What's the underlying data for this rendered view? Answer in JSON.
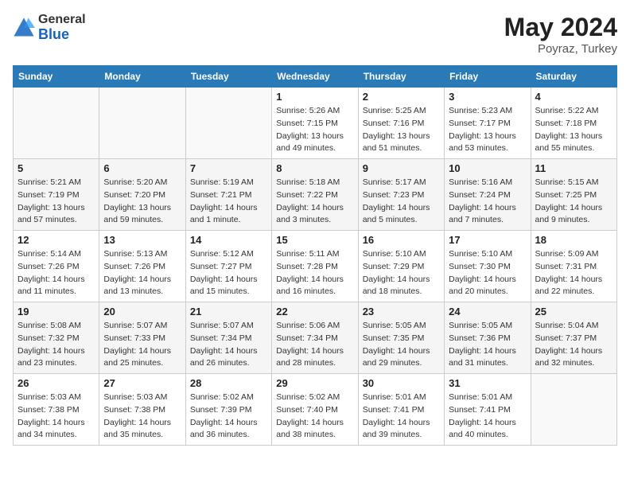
{
  "header": {
    "logo_line1": "General",
    "logo_line2": "Blue",
    "month_year": "May 2024",
    "location": "Poyraz, Turkey"
  },
  "weekdays": [
    "Sunday",
    "Monday",
    "Tuesday",
    "Wednesday",
    "Thursday",
    "Friday",
    "Saturday"
  ],
  "weeks": [
    [
      {
        "day": "",
        "sunrise": "",
        "sunset": "",
        "daylight": ""
      },
      {
        "day": "",
        "sunrise": "",
        "sunset": "",
        "daylight": ""
      },
      {
        "day": "",
        "sunrise": "",
        "sunset": "",
        "daylight": ""
      },
      {
        "day": "1",
        "sunrise": "Sunrise: 5:26 AM",
        "sunset": "Sunset: 7:15 PM",
        "daylight": "Daylight: 13 hours and 49 minutes."
      },
      {
        "day": "2",
        "sunrise": "Sunrise: 5:25 AM",
        "sunset": "Sunset: 7:16 PM",
        "daylight": "Daylight: 13 hours and 51 minutes."
      },
      {
        "day": "3",
        "sunrise": "Sunrise: 5:23 AM",
        "sunset": "Sunset: 7:17 PM",
        "daylight": "Daylight: 13 hours and 53 minutes."
      },
      {
        "day": "4",
        "sunrise": "Sunrise: 5:22 AM",
        "sunset": "Sunset: 7:18 PM",
        "daylight": "Daylight: 13 hours and 55 minutes."
      }
    ],
    [
      {
        "day": "5",
        "sunrise": "Sunrise: 5:21 AM",
        "sunset": "Sunset: 7:19 PM",
        "daylight": "Daylight: 13 hours and 57 minutes."
      },
      {
        "day": "6",
        "sunrise": "Sunrise: 5:20 AM",
        "sunset": "Sunset: 7:20 PM",
        "daylight": "Daylight: 13 hours and 59 minutes."
      },
      {
        "day": "7",
        "sunrise": "Sunrise: 5:19 AM",
        "sunset": "Sunset: 7:21 PM",
        "daylight": "Daylight: 14 hours and 1 minute."
      },
      {
        "day": "8",
        "sunrise": "Sunrise: 5:18 AM",
        "sunset": "Sunset: 7:22 PM",
        "daylight": "Daylight: 14 hours and 3 minutes."
      },
      {
        "day": "9",
        "sunrise": "Sunrise: 5:17 AM",
        "sunset": "Sunset: 7:23 PM",
        "daylight": "Daylight: 14 hours and 5 minutes."
      },
      {
        "day": "10",
        "sunrise": "Sunrise: 5:16 AM",
        "sunset": "Sunset: 7:24 PM",
        "daylight": "Daylight: 14 hours and 7 minutes."
      },
      {
        "day": "11",
        "sunrise": "Sunrise: 5:15 AM",
        "sunset": "Sunset: 7:25 PM",
        "daylight": "Daylight: 14 hours and 9 minutes."
      }
    ],
    [
      {
        "day": "12",
        "sunrise": "Sunrise: 5:14 AM",
        "sunset": "Sunset: 7:26 PM",
        "daylight": "Daylight: 14 hours and 11 minutes."
      },
      {
        "day": "13",
        "sunrise": "Sunrise: 5:13 AM",
        "sunset": "Sunset: 7:26 PM",
        "daylight": "Daylight: 14 hours and 13 minutes."
      },
      {
        "day": "14",
        "sunrise": "Sunrise: 5:12 AM",
        "sunset": "Sunset: 7:27 PM",
        "daylight": "Daylight: 14 hours and 15 minutes."
      },
      {
        "day": "15",
        "sunrise": "Sunrise: 5:11 AM",
        "sunset": "Sunset: 7:28 PM",
        "daylight": "Daylight: 14 hours and 16 minutes."
      },
      {
        "day": "16",
        "sunrise": "Sunrise: 5:10 AM",
        "sunset": "Sunset: 7:29 PM",
        "daylight": "Daylight: 14 hours and 18 minutes."
      },
      {
        "day": "17",
        "sunrise": "Sunrise: 5:10 AM",
        "sunset": "Sunset: 7:30 PM",
        "daylight": "Daylight: 14 hours and 20 minutes."
      },
      {
        "day": "18",
        "sunrise": "Sunrise: 5:09 AM",
        "sunset": "Sunset: 7:31 PM",
        "daylight": "Daylight: 14 hours and 22 minutes."
      }
    ],
    [
      {
        "day": "19",
        "sunrise": "Sunrise: 5:08 AM",
        "sunset": "Sunset: 7:32 PM",
        "daylight": "Daylight: 14 hours and 23 minutes."
      },
      {
        "day": "20",
        "sunrise": "Sunrise: 5:07 AM",
        "sunset": "Sunset: 7:33 PM",
        "daylight": "Daylight: 14 hours and 25 minutes."
      },
      {
        "day": "21",
        "sunrise": "Sunrise: 5:07 AM",
        "sunset": "Sunset: 7:34 PM",
        "daylight": "Daylight: 14 hours and 26 minutes."
      },
      {
        "day": "22",
        "sunrise": "Sunrise: 5:06 AM",
        "sunset": "Sunset: 7:34 PM",
        "daylight": "Daylight: 14 hours and 28 minutes."
      },
      {
        "day": "23",
        "sunrise": "Sunrise: 5:05 AM",
        "sunset": "Sunset: 7:35 PM",
        "daylight": "Daylight: 14 hours and 29 minutes."
      },
      {
        "day": "24",
        "sunrise": "Sunrise: 5:05 AM",
        "sunset": "Sunset: 7:36 PM",
        "daylight": "Daylight: 14 hours and 31 minutes."
      },
      {
        "day": "25",
        "sunrise": "Sunrise: 5:04 AM",
        "sunset": "Sunset: 7:37 PM",
        "daylight": "Daylight: 14 hours and 32 minutes."
      }
    ],
    [
      {
        "day": "26",
        "sunrise": "Sunrise: 5:03 AM",
        "sunset": "Sunset: 7:38 PM",
        "daylight": "Daylight: 14 hours and 34 minutes."
      },
      {
        "day": "27",
        "sunrise": "Sunrise: 5:03 AM",
        "sunset": "Sunset: 7:38 PM",
        "daylight": "Daylight: 14 hours and 35 minutes."
      },
      {
        "day": "28",
        "sunrise": "Sunrise: 5:02 AM",
        "sunset": "Sunset: 7:39 PM",
        "daylight": "Daylight: 14 hours and 36 minutes."
      },
      {
        "day": "29",
        "sunrise": "Sunrise: 5:02 AM",
        "sunset": "Sunset: 7:40 PM",
        "daylight": "Daylight: 14 hours and 38 minutes."
      },
      {
        "day": "30",
        "sunrise": "Sunrise: 5:01 AM",
        "sunset": "Sunset: 7:41 PM",
        "daylight": "Daylight: 14 hours and 39 minutes."
      },
      {
        "day": "31",
        "sunrise": "Sunrise: 5:01 AM",
        "sunset": "Sunset: 7:41 PM",
        "daylight": "Daylight: 14 hours and 40 minutes."
      },
      {
        "day": "",
        "sunrise": "",
        "sunset": "",
        "daylight": ""
      }
    ]
  ]
}
